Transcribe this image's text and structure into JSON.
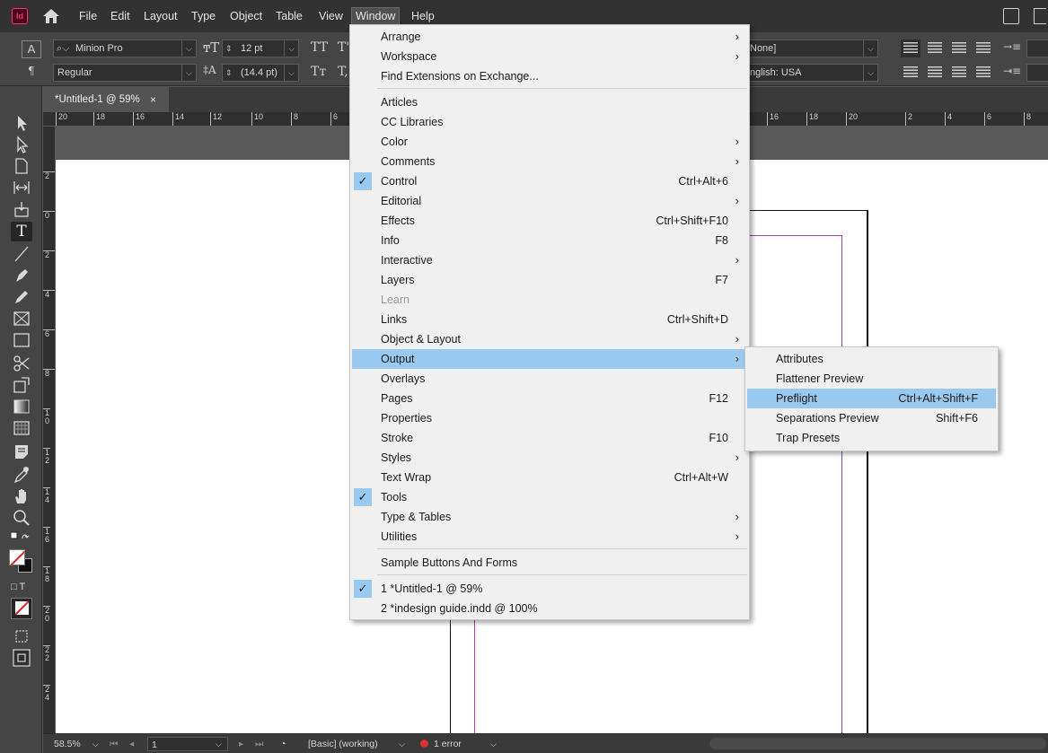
{
  "menubar": {
    "app_icon": "Id",
    "items": [
      "File",
      "Edit",
      "Layout",
      "Type",
      "Object",
      "Table",
      "View",
      "Window",
      "Help"
    ],
    "active": "Window"
  },
  "control_panel": {
    "font_family": "Minion Pro",
    "font_style": "Regular",
    "font_size": "12 pt",
    "leading": "(14.4 pt)",
    "char_style": "None]",
    "language": "nglish: USA",
    "caps_glyph": "TT",
    "smallcaps_glyph": "Tт",
    "super_glyph": "T'",
    "sub_glyph": "T,",
    "style_glyph": "A",
    "para_glyph": "¶"
  },
  "tab": {
    "title": "*Untitled-1 @ 59%",
    "close": "×"
  },
  "ruler_h": [
    "20",
    "18",
    "16",
    "14",
    "12",
    "10",
    "8",
    "6",
    "16",
    "18",
    "20",
    "2",
    "4",
    "6",
    "8"
  ],
  "ruler_v": [
    "2",
    "0",
    "2",
    "4",
    "6",
    "8",
    "1 0",
    "1 2",
    "1 4",
    "1 6",
    "1 8",
    "2 0",
    "2 2",
    "2 4"
  ],
  "window_menu": {
    "items": [
      {
        "label": "Arrange",
        "submenu": true
      },
      {
        "label": "Workspace",
        "submenu": true
      },
      {
        "label": "Find Extensions on Exchange..."
      },
      {
        "separator": true
      },
      {
        "label": "Articles"
      },
      {
        "label": "CC Libraries"
      },
      {
        "label": "Color",
        "submenu": true
      },
      {
        "label": "Comments",
        "submenu": true
      },
      {
        "label": "Control",
        "shortcut": "Ctrl+Alt+6",
        "checked": true
      },
      {
        "label": "Editorial",
        "submenu": true
      },
      {
        "label": "Effects",
        "shortcut": "Ctrl+Shift+F10"
      },
      {
        "label": "Info",
        "shortcut": "F8"
      },
      {
        "label": "Interactive",
        "submenu": true
      },
      {
        "label": "Layers",
        "shortcut": "F7"
      },
      {
        "label": "Learn",
        "disabled": true
      },
      {
        "label": "Links",
        "shortcut": "Ctrl+Shift+D"
      },
      {
        "label": "Object & Layout",
        "submenu": true
      },
      {
        "label": "Output",
        "submenu": true,
        "highlighted": true
      },
      {
        "label": "Overlays"
      },
      {
        "label": "Pages",
        "shortcut": "F12"
      },
      {
        "label": "Properties"
      },
      {
        "label": "Stroke",
        "shortcut": "F10"
      },
      {
        "label": "Styles",
        "submenu": true
      },
      {
        "label": "Text Wrap",
        "shortcut": "Ctrl+Alt+W"
      },
      {
        "label": "Tools",
        "checked": true
      },
      {
        "label": "Type & Tables",
        "submenu": true
      },
      {
        "label": "Utilities",
        "submenu": true
      },
      {
        "separator": true
      },
      {
        "label": "Sample Buttons And Forms"
      },
      {
        "separator": true
      },
      {
        "label": "1 *Untitled-1 @ 59%",
        "checked": true
      },
      {
        "label": "2 *indesign guide.indd @ 100%"
      }
    ]
  },
  "output_menu": {
    "items": [
      {
        "label": "Attributes"
      },
      {
        "label": "Flattener Preview"
      },
      {
        "label": "Preflight",
        "shortcut": "Ctrl+Alt+Shift+F",
        "highlighted": true
      },
      {
        "label": "Separations Preview",
        "shortcut": "Shift+F6"
      },
      {
        "label": "Trap Presets"
      }
    ]
  },
  "statusbar": {
    "zoom": "58.5%",
    "page": "1",
    "profile": "[Basic] (working)",
    "errors": "1 error",
    "error_color": "#e03030"
  },
  "glyphs": {
    "check": "✓",
    "submenu_arrow": "›",
    "dropdown": "⌵"
  }
}
